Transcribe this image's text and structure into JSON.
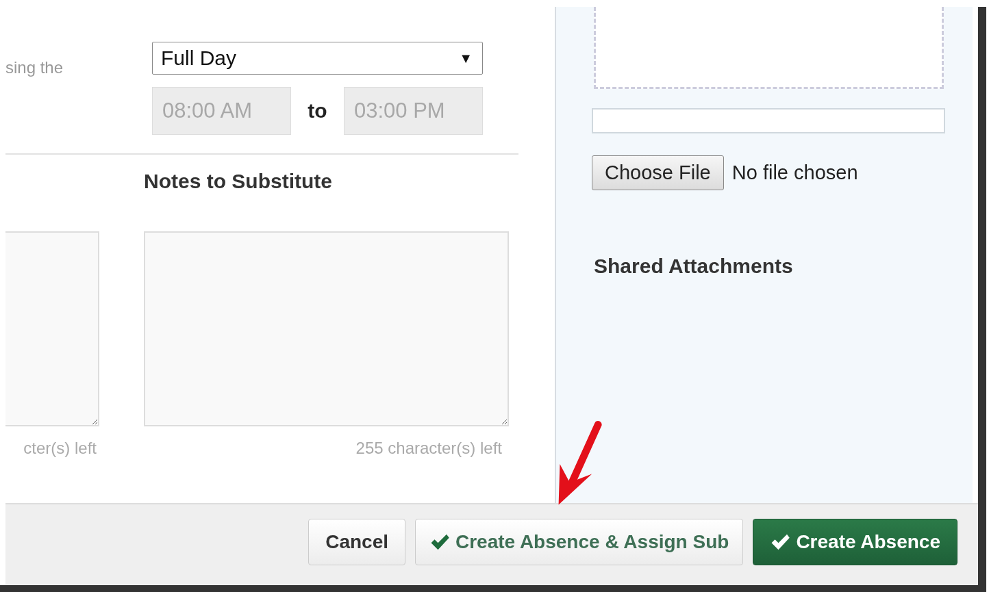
{
  "absence_form": {
    "cut_label": "sing the",
    "duration_select": {
      "value": "Full Day",
      "arrow": "▼"
    },
    "start_time": {
      "value": "08:00 AM",
      "disabled": true
    },
    "time_connector": "to",
    "end_time": {
      "value": "03:00 PM",
      "disabled": true
    },
    "notes_heading": "Notes to Substitute",
    "note_fields": [
      {
        "counter": "cter(s) left"
      },
      {
        "counter": "255 character(s) left"
      }
    ]
  },
  "attachments": {
    "file_button": "Choose File",
    "file_status": "No file chosen",
    "shared_heading": "Shared Attachments"
  },
  "buttons": [
    {
      "label": "Cancel",
      "kind": "default",
      "check": false
    },
    {
      "label": "Create Absence & Assign Sub",
      "kind": "secondary",
      "check": true
    },
    {
      "label": "Create Absence",
      "kind": "primary",
      "check": true
    }
  ]
}
